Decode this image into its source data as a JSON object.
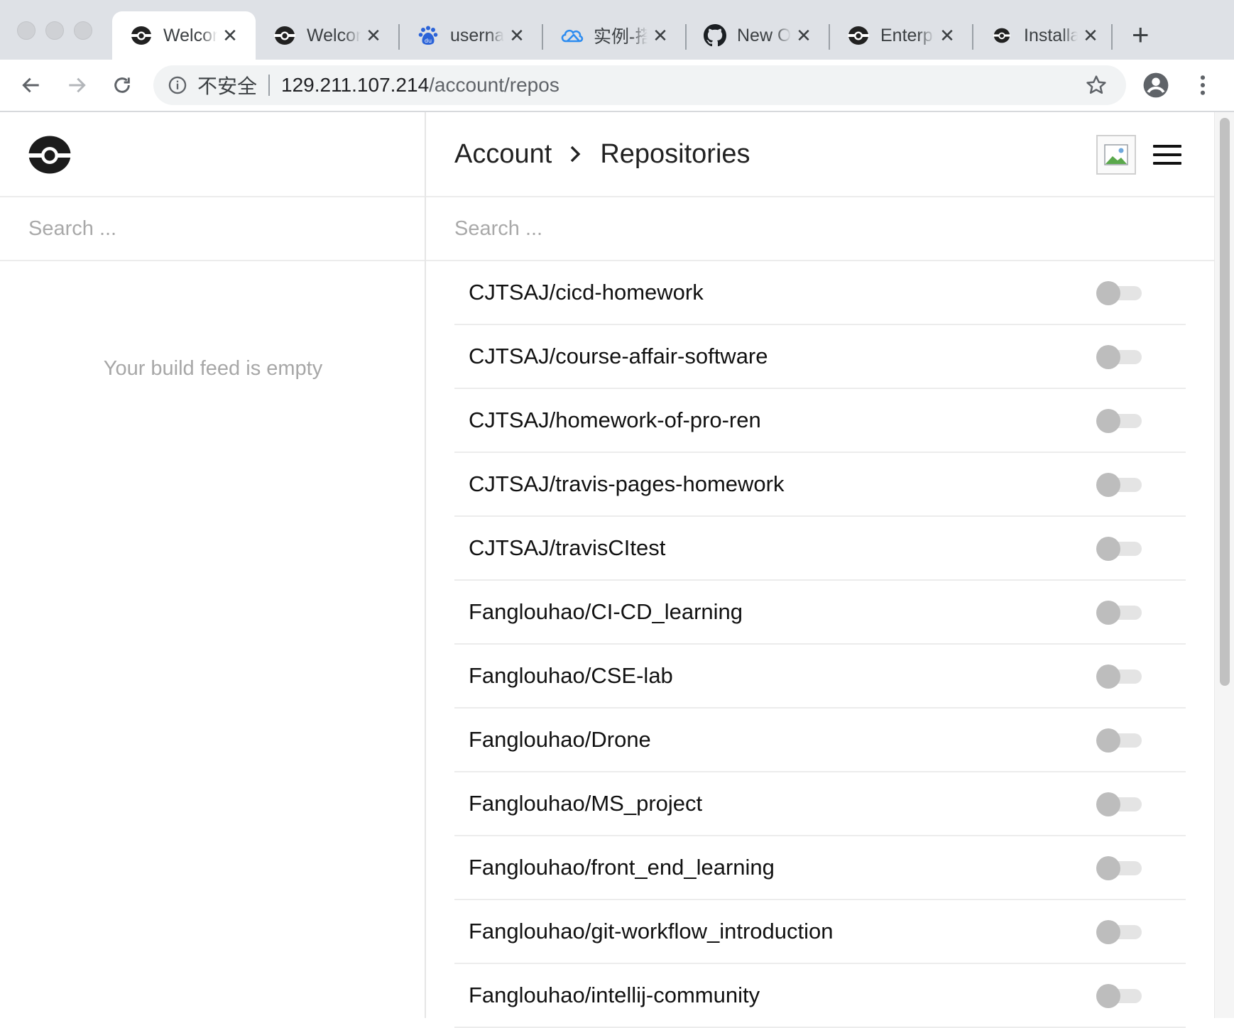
{
  "browser": {
    "tabs": [
      {
        "title": "Welcome",
        "icon": "drone-icon",
        "active": true
      },
      {
        "title": "Welcome",
        "icon": "drone-icon",
        "active": false
      },
      {
        "title": "username",
        "icon": "baidu-icon",
        "active": false
      },
      {
        "title": "实例-搭建",
        "icon": "cloud-icon",
        "active": false
      },
      {
        "title": "New OAuth",
        "icon": "github-icon",
        "active": false
      },
      {
        "title": "Enterprise",
        "icon": "drone-icon",
        "active": false
      },
      {
        "title": "Installation",
        "icon": "drone-icon",
        "active": false
      }
    ],
    "close_glyph": "✕",
    "new_tab_glyph": "+",
    "security_label": "不安全",
    "url_host": "129.211.107.214",
    "url_path": "/account/repos"
  },
  "sidebar": {
    "search_placeholder": "Search ...",
    "empty_message": "Your build feed is empty"
  },
  "header": {
    "breadcrumb": [
      "Account",
      "Repositories"
    ]
  },
  "main": {
    "search_placeholder": "Search ...",
    "repos": [
      {
        "name": "CJTSAJ/cicd-homework",
        "active": false
      },
      {
        "name": "CJTSAJ/course-affair-software",
        "active": false
      },
      {
        "name": "CJTSAJ/homework-of-pro-ren",
        "active": false
      },
      {
        "name": "CJTSAJ/travis-pages-homework",
        "active": false
      },
      {
        "name": "CJTSAJ/travisCItest",
        "active": false
      },
      {
        "name": "Fanglouhao/CI-CD_learning",
        "active": false
      },
      {
        "name": "Fanglouhao/CSE-lab",
        "active": false
      },
      {
        "name": "Fanglouhao/Drone",
        "active": false
      },
      {
        "name": "Fanglouhao/MS_project",
        "active": false
      },
      {
        "name": "Fanglouhao/front_end_learning",
        "active": false
      },
      {
        "name": "Fanglouhao/git-workflow_introduction",
        "active": false
      },
      {
        "name": "Fanglouhao/intellij-community",
        "active": false
      }
    ]
  },
  "colors": {
    "toggle_knob_off": "#bdbdbd",
    "toggle_track_off": "#e4e4e4",
    "tabstrip_bg": "#dee1e6"
  }
}
